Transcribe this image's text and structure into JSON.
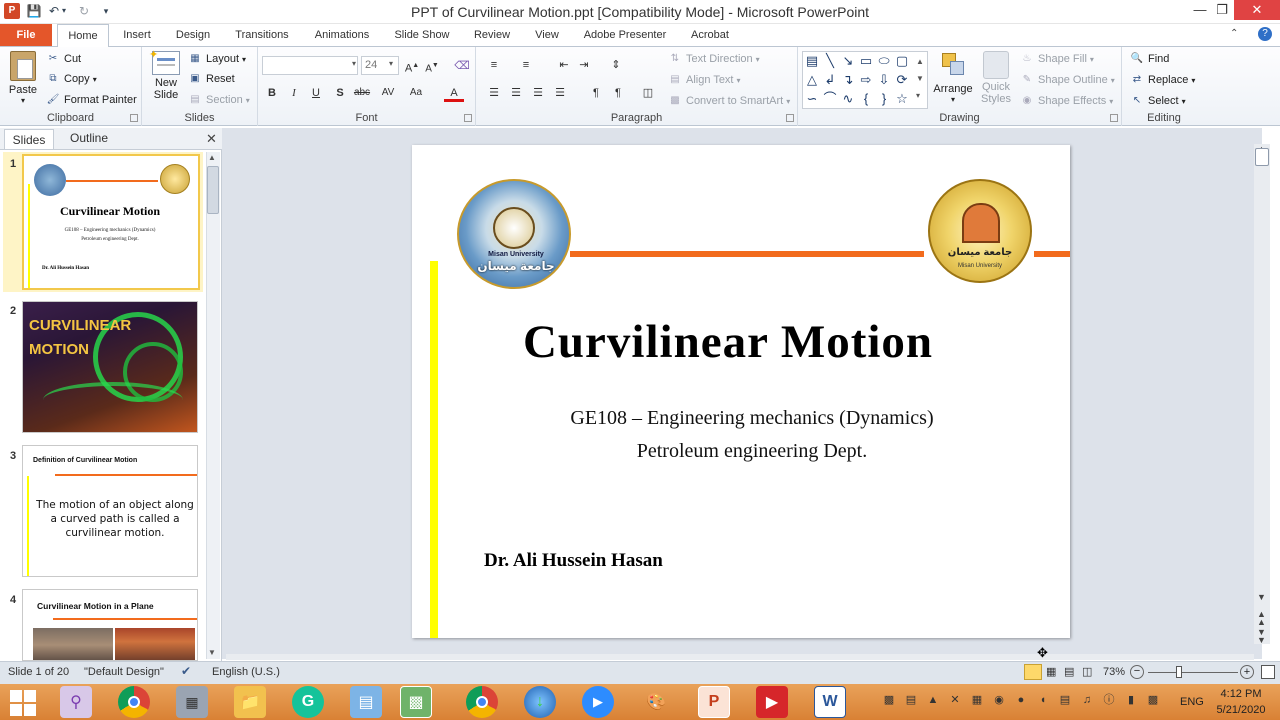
{
  "window": {
    "title": "PPT of Curvilinear Motion.ppt [Compatibility Mode]  -  Microsoft PowerPoint"
  },
  "menu": {
    "tabs": [
      "File",
      "Home",
      "Insert",
      "Design",
      "Transitions",
      "Animations",
      "Slide Show",
      "Review",
      "View",
      "Adobe Presenter",
      "Acrobat"
    ]
  },
  "ribbon": {
    "clipboard": {
      "label": "Clipboard",
      "paste": "Paste",
      "cut": "Cut",
      "copy": "Copy",
      "format_painter": "Format Painter"
    },
    "slides": {
      "label": "Slides",
      "new_slide": "New Slide",
      "layout": "Layout",
      "reset": "Reset",
      "section": "Section"
    },
    "font": {
      "label": "Font",
      "font_name": "",
      "font_size": "24"
    },
    "paragraph": {
      "label": "Paragraph",
      "text_direction": "Text Direction",
      "align_text": "Align Text",
      "convert_smartart": "Convert to SmartArt"
    },
    "drawing": {
      "label": "Drawing",
      "arrange": "Arrange",
      "quick_styles": "Quick Styles",
      "shape_fill": "Shape Fill",
      "shape_outline": "Shape Outline",
      "shape_effects": "Shape Effects"
    },
    "editing": {
      "label": "Editing",
      "find": "Find",
      "replace": "Replace",
      "select": "Select"
    }
  },
  "left_pane": {
    "tabs": [
      "Slides",
      "Outline"
    ],
    "thumbnails": [
      {
        "num": "1",
        "title": "Curvilinear Motion",
        "line1": "GE108  – Engineering mechanics (Dynamics)",
        "line2": "Petroleum engineering Dept.",
        "author": "Dr. Ali  Hussein Hasan"
      },
      {
        "num": "2",
        "title": "CURVILINEAR MOTION"
      },
      {
        "num": "3",
        "title": "Definition  of Curvilinear  Motion",
        "body": "The motion of an object along a curved path is called a curvilinear motion."
      },
      {
        "num": "4",
        "title": "Curvilinear Motion in a Plane"
      }
    ]
  },
  "slide": {
    "title": "Curvilinear Motion",
    "subtitle_line1": "GE108  – Engineering  mechanics  (Dynamics)",
    "subtitle_line2": "Petroleum  engineering  Dept.",
    "author": "Dr. Ali  Hussein  Hasan",
    "left_logo_text": "Misan  University",
    "left_logo_arabic": "جامعة ميسان",
    "right_logo_arabic": "جامعة ميسان",
    "right_logo_text": "Misan University"
  },
  "status": {
    "slide_of": "Slide 1 of 20",
    "theme": "\"Default Design\"",
    "language": "English (U.S.)",
    "zoom": "73%"
  },
  "taskbar": {
    "lang": "ENG",
    "time": "4:12 PM",
    "date": "5/21/2020"
  },
  "colors": {
    "accent_orange": "#f26b1d",
    "accent_yellow": "#ffff00",
    "file_tab": "#e4562a",
    "taskbar": "#d98134"
  }
}
